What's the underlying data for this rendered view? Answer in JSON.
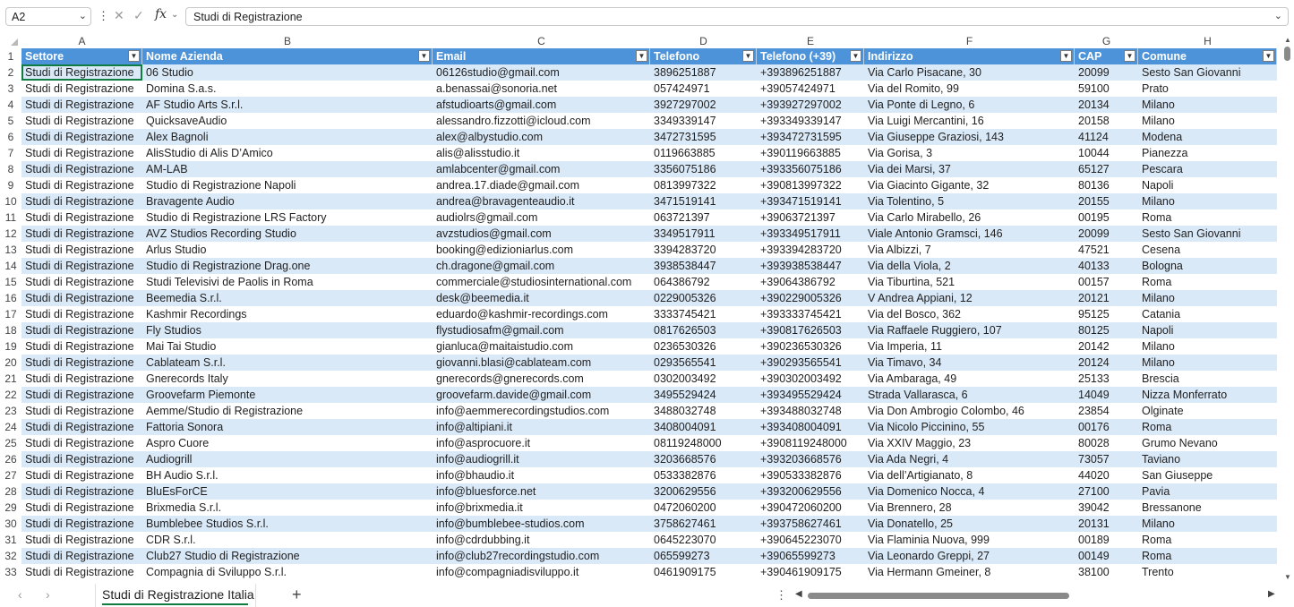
{
  "formula_bar": {
    "name_box": "A2",
    "formula": "Studi di Registrazione"
  },
  "columns": [
    "A",
    "B",
    "C",
    "D",
    "E",
    "F",
    "G",
    "H"
  ],
  "headers": [
    "Settore",
    "Nome Azienda",
    "Email",
    "Telefono",
    "Telefono (+39)",
    "Indirizzo",
    "CAP",
    "Comune"
  ],
  "header_row_number": "1",
  "rows": [
    {
      "n": "2",
      "c": [
        "Studi di Registrazione",
        "06 Studio",
        "06126studio@gmail.com",
        "3896251887",
        "+393896251887",
        "Via Carlo Pisacane, 30",
        "20099",
        "Sesto San Giovanni"
      ]
    },
    {
      "n": "3",
      "c": [
        "Studi di Registrazione",
        "Domina S.a.s.",
        "a.benassai@sonoria.net",
        "057424971",
        "+39057424971",
        "Via del Romito, 99",
        "59100",
        "Prato"
      ]
    },
    {
      "n": "4",
      "c": [
        "Studi di Registrazione",
        "AF Studio Arts S.r.l.",
        "afstudioarts@gmail.com",
        "3927297002",
        "+393927297002",
        "Via Ponte di Legno, 6",
        "20134",
        "Milano"
      ]
    },
    {
      "n": "5",
      "c": [
        "Studi di Registrazione",
        "QuicksaveAudio",
        "alessandro.fizzotti@icloud.com",
        "3349339147",
        "+393349339147",
        "Via Luigi Mercantini, 16",
        "20158",
        "Milano"
      ]
    },
    {
      "n": "6",
      "c": [
        "Studi di Registrazione",
        "Alex Bagnoli",
        "alex@albystudio.com",
        "3472731595",
        "+393472731595",
        "Via Giuseppe Graziosi, 143",
        "41124",
        "Modena"
      ]
    },
    {
      "n": "7",
      "c": [
        "Studi di Registrazione",
        "AlisStudio di Alis D’Amico",
        "alis@alisstudio.it",
        "0119663885",
        "+390119663885",
        "Via Gorisa, 3",
        "10044",
        "Pianezza"
      ]
    },
    {
      "n": "8",
      "c": [
        "Studi di Registrazione",
        "AM-LAB",
        "amlabcenter@gmail.com",
        "3356075186",
        "+393356075186",
        "Via dei Marsi, 37",
        "65127",
        "Pescara"
      ]
    },
    {
      "n": "9",
      "c": [
        "Studi di Registrazione",
        "Studio di Registrazione Napoli",
        "andrea.17.diade@gmail.com",
        "0813997322",
        "+390813997322",
        "Via Giacinto Gigante, 32",
        "80136",
        "Napoli"
      ]
    },
    {
      "n": "10",
      "c": [
        "Studi di Registrazione",
        "Bravagente Audio",
        "andrea@bravagenteaudio.it",
        "3471519141",
        "+393471519141",
        "Via Tolentino, 5",
        "20155",
        "Milano"
      ]
    },
    {
      "n": "11",
      "c": [
        "Studi di Registrazione",
        "Studio di Registrazione LRS Factory",
        "audiolrs@gmail.com",
        "063721397",
        "+39063721397",
        "Via Carlo Mirabello, 26",
        "00195",
        "Roma"
      ]
    },
    {
      "n": "12",
      "c": [
        "Studi di Registrazione",
        "AVZ Studios Recording Studio",
        "avzstudios@gmail.com",
        "3349517911",
        "+393349517911",
        "Viale Antonio Gramsci, 146",
        "20099",
        "Sesto San Giovanni"
      ]
    },
    {
      "n": "13",
      "c": [
        "Studi di Registrazione",
        "Arlus Studio",
        "booking@edizioniarlus.com",
        "3394283720",
        "+393394283720",
        "Via Albizzi, 7",
        "47521",
        "Cesena"
      ]
    },
    {
      "n": "14",
      "c": [
        "Studi di Registrazione",
        "Studio di Registrazione Drag.one",
        "ch.dragone@gmail.com",
        "3938538447",
        "+393938538447",
        "Via della Viola, 2",
        "40133",
        "Bologna"
      ]
    },
    {
      "n": "15",
      "c": [
        "Studi di Registrazione",
        "Studi Televisivi de Paolis in Roma",
        "commerciale@studiosinternational.com",
        "064386792",
        "+39064386792",
        "Via Tiburtina, 521",
        "00157",
        "Roma"
      ]
    },
    {
      "n": "16",
      "c": [
        "Studi di Registrazione",
        "Beemedia S.r.l.",
        "desk@beemedia.it",
        "0229005326",
        "+390229005326",
        "V Andrea Appiani, 12",
        "20121",
        "Milano"
      ]
    },
    {
      "n": "17",
      "c": [
        "Studi di Registrazione",
        "Kashmir Recordings",
        "eduardo@kashmir-recordings.com",
        "3333745421",
        "+393333745421",
        "Via del Bosco, 362",
        "95125",
        "Catania"
      ]
    },
    {
      "n": "18",
      "c": [
        "Studi di Registrazione",
        "Fly Studios",
        "flystudiosafm@gmail.com",
        "0817626503",
        "+390817626503",
        "Via Raffaele Ruggiero, 107",
        "80125",
        "Napoli"
      ]
    },
    {
      "n": "19",
      "c": [
        "Studi di Registrazione",
        "Mai Tai Studio",
        "gianluca@maitaistudio.com",
        "0236530326",
        "+390236530326",
        "Via Imperia, 11",
        "20142",
        "Milano"
      ]
    },
    {
      "n": "20",
      "c": [
        "Studi di Registrazione",
        "Cablateam S.r.l.",
        "giovanni.blasi@cablateam.com",
        "0293565541",
        "+390293565541",
        "Via Timavo, 34",
        "20124",
        "Milano"
      ]
    },
    {
      "n": "21",
      "c": [
        "Studi di Registrazione",
        "Gnerecords Italy",
        "gnerecords@gnerecords.com",
        "0302003492",
        "+390302003492",
        "Via Ambaraga, 49",
        "25133",
        "Brescia"
      ]
    },
    {
      "n": "22",
      "c": [
        "Studi di Registrazione",
        "Groovefarm Piemonte",
        "groovefarm.davide@gmail.com",
        "3495529424",
        "+393495529424",
        "Strada Vallarasca, 6",
        "14049",
        "Nizza Monferrato"
      ]
    },
    {
      "n": "23",
      "c": [
        "Studi di Registrazione",
        "Aemme/Studio di Registrazione",
        "info@aemmerecordingstudios.com",
        "3488032748",
        "+393488032748",
        "Via Don Ambrogio Colombo, 46",
        "23854",
        "Olginate"
      ]
    },
    {
      "n": "24",
      "c": [
        "Studi di Registrazione",
        "Fattoria Sonora",
        "info@altipiani.it",
        "3408004091",
        "+393408004091",
        "Via Nicolo Piccinino, 55",
        "00176",
        "Roma"
      ]
    },
    {
      "n": "25",
      "c": [
        "Studi di Registrazione",
        "Aspro Cuore",
        "info@asprocuore.it",
        "08119248000",
        "+3908119248000",
        "Via XXIV Maggio, 23",
        "80028",
        "Grumo Nevano"
      ]
    },
    {
      "n": "26",
      "c": [
        "Studi di Registrazione",
        "Audiogrill",
        "info@audiogrill.it",
        "3203668576",
        "+393203668576",
        "Via Ada Negri, 4",
        "73057",
        "Taviano"
      ]
    },
    {
      "n": "27",
      "c": [
        "Studi di Registrazione",
        "BH Audio S.r.l.",
        "info@bhaudio.it",
        "0533382876",
        "+390533382876",
        "Via dell’Artigianato, 8",
        "44020",
        "San Giuseppe"
      ]
    },
    {
      "n": "28",
      "c": [
        "Studi di Registrazione",
        "BluEsForCE",
        "info@bluesforce.net",
        "3200629556",
        "+393200629556",
        "Via Domenico Nocca, 4",
        "27100",
        "Pavia"
      ]
    },
    {
      "n": "29",
      "c": [
        "Studi di Registrazione",
        "Brixmedia S.r.l.",
        "info@brixmedia.it",
        "0472060200",
        "+390472060200",
        "Via Brennero, 28",
        "39042",
        "Bressanone"
      ]
    },
    {
      "n": "30",
      "c": [
        "Studi di Registrazione",
        "Bumblebee Studios S.r.l.",
        "info@bumblebee-studios.com",
        "3758627461",
        "+393758627461",
        "Via Donatello, 25",
        "20131",
        "Milano"
      ]
    },
    {
      "n": "31",
      "c": [
        "Studi di Registrazione",
        "CDR S.r.l.",
        "info@cdrdubbing.it",
        "0645223070",
        "+390645223070",
        "Via Flaminia Nuova, 999",
        "00189",
        "Roma"
      ]
    },
    {
      "n": "32",
      "c": [
        "Studi di Registrazione",
        "Club27 Studio di Registrazione",
        "info@club27recordingstudio.com",
        "065599273",
        "+39065599273",
        "Via Leonardo Greppi, 27",
        "00149",
        "Roma"
      ]
    },
    {
      "n": "33",
      "c": [
        "Studi di Registrazione",
        "Compagnia di Sviluppo S.r.l.",
        "info@compagniadisviluppo.it",
        "0461909175",
        "+390461909175",
        "Via Hermann Gmeiner, 8",
        "38100",
        "Trento"
      ]
    }
  ],
  "sheet_tab": "Studi di Registrazione Italia",
  "colors": {
    "header_fill": "#4d93d9",
    "band_fill": "#dae9f8",
    "accent": "#107c41"
  }
}
